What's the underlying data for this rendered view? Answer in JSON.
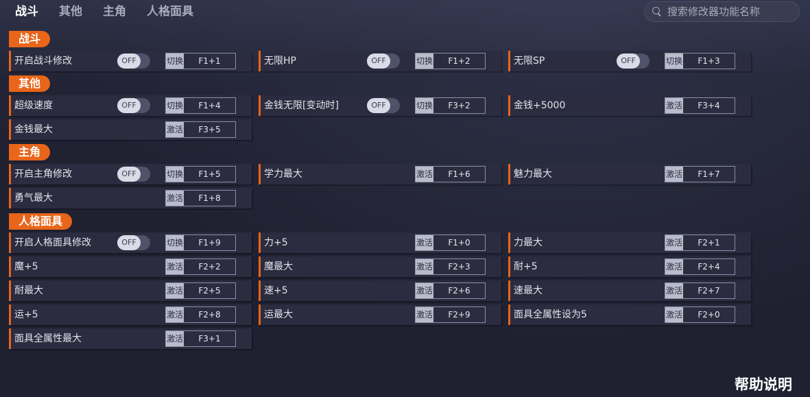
{
  "tabs": [
    "战斗",
    "其他",
    "主角",
    "人格面具"
  ],
  "search": {
    "placeholder": "搜索修改器功能名称"
  },
  "toggle_off": "OFF",
  "sections": [
    "战斗",
    "其他",
    "主角",
    "人格面具"
  ],
  "rows": [
    {
      "name": "开启战斗修改",
      "toggle": true,
      "action": "切换",
      "key": "F1+1"
    },
    {
      "name": "无限HP",
      "toggle": true,
      "action": "切换",
      "key": "F1+2"
    },
    {
      "name": "无限SP",
      "toggle": true,
      "action": "切换",
      "key": "F1+3"
    },
    {
      "name": "超级速度",
      "toggle": true,
      "action": "切换",
      "key": "F1+4"
    },
    {
      "name": "金钱无限[变动时]",
      "toggle": true,
      "action": "切换",
      "key": "F3+2"
    },
    {
      "name": "金钱+5000",
      "toggle": false,
      "action": "激活",
      "key": "F3+4"
    },
    {
      "name": "金钱最大",
      "toggle": false,
      "action": "激活",
      "key": "F3+5"
    },
    {
      "name": "开启主角修改",
      "toggle": true,
      "action": "切换",
      "key": "F1+5"
    },
    {
      "name": "学力最大",
      "toggle": false,
      "action": "激活",
      "key": "F1+6"
    },
    {
      "name": "魅力最大",
      "toggle": false,
      "action": "激活",
      "key": "F1+7"
    },
    {
      "name": "勇气最大",
      "toggle": false,
      "action": "激活",
      "key": "F1+8"
    },
    {
      "name": "开启人格面具修改",
      "toggle": true,
      "action": "切换",
      "key": "F1+9"
    },
    {
      "name": "力+5",
      "toggle": false,
      "action": "激活",
      "key": "F1+0"
    },
    {
      "name": "力最大",
      "toggle": false,
      "action": "激活",
      "key": "F2+1"
    },
    {
      "name": "魔+5",
      "toggle": false,
      "action": "激活",
      "key": "F2+2"
    },
    {
      "name": "魔最大",
      "toggle": false,
      "action": "激活",
      "key": "F2+3"
    },
    {
      "name": "耐+5",
      "toggle": false,
      "action": "激活",
      "key": "F2+4"
    },
    {
      "name": "耐最大",
      "toggle": false,
      "action": "激活",
      "key": "F2+5"
    },
    {
      "name": "速+5",
      "toggle": false,
      "action": "激活",
      "key": "F2+6"
    },
    {
      "name": "速最大",
      "toggle": false,
      "action": "激活",
      "key": "F2+7"
    },
    {
      "name": "运+5",
      "toggle": false,
      "action": "激活",
      "key": "F2+8"
    },
    {
      "name": "运最大",
      "toggle": false,
      "action": "激活",
      "key": "F2+9"
    },
    {
      "name": "面具全属性设为5",
      "toggle": false,
      "action": "激活",
      "key": "F2+0"
    },
    {
      "name": "面具全属性最大",
      "toggle": false,
      "action": "激活",
      "key": "F3+1"
    }
  ],
  "help_label": "帮助说明",
  "colors": {
    "accent": "#e8651a",
    "background": "#1f2030",
    "row": "#2b2c3f"
  }
}
